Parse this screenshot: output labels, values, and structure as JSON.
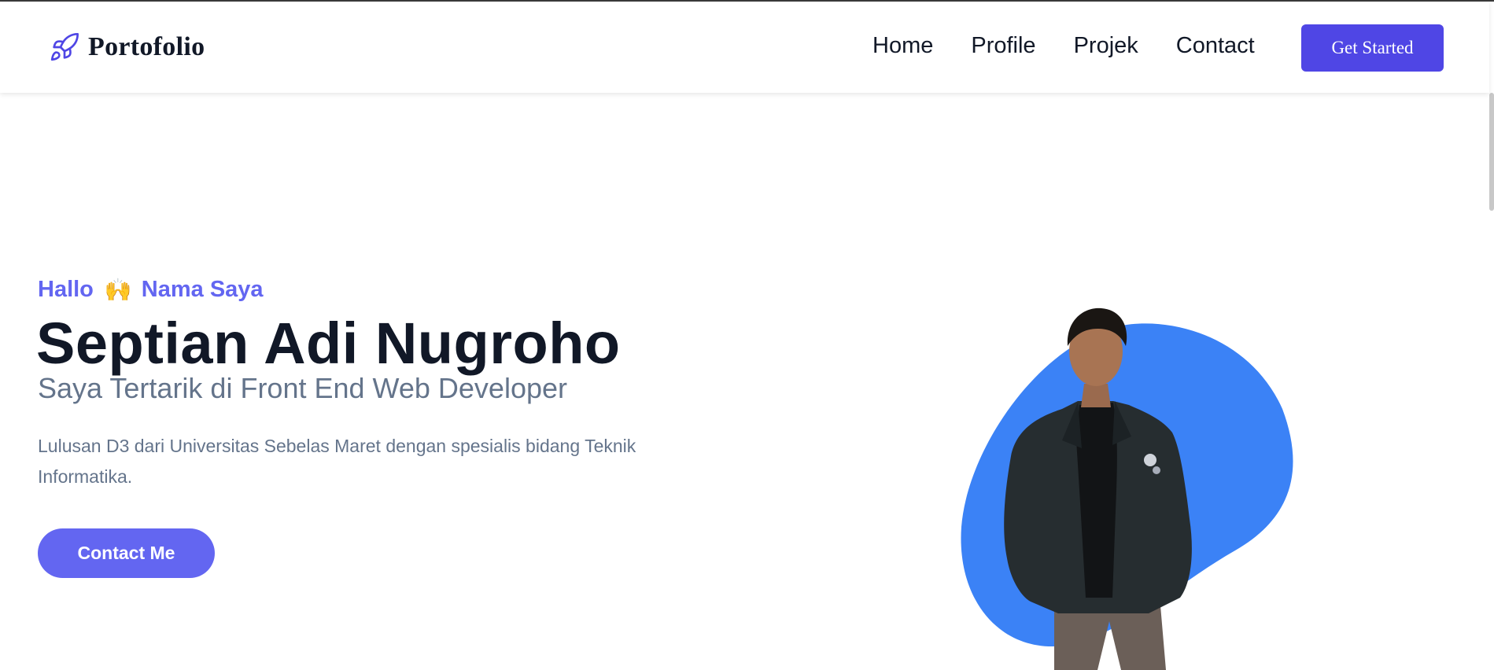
{
  "nav": {
    "brand": "Portofolio",
    "brand_icon": "rocket-icon",
    "links": [
      "Home",
      "Profile",
      "Projek",
      "Contact"
    ],
    "cta_label": "Get Started"
  },
  "hero": {
    "greeting_pre": "Hallo",
    "greeting_emoji": "🙌",
    "greeting_post": "Nama Saya",
    "name": "Septian Adi Nugroho",
    "subtitle": "Saya Tertarik di Front End Web Developer",
    "description": "Lulusan D3 dari Universitas Sebelas Maret dengan spesialis bidang Teknik Informatika.",
    "contact_label": "Contact Me"
  },
  "colors": {
    "accent": "#4f46e5",
    "accent_light": "#6366f1",
    "blob": "#3b82f6",
    "heading": "#111827",
    "muted": "#64748b"
  }
}
